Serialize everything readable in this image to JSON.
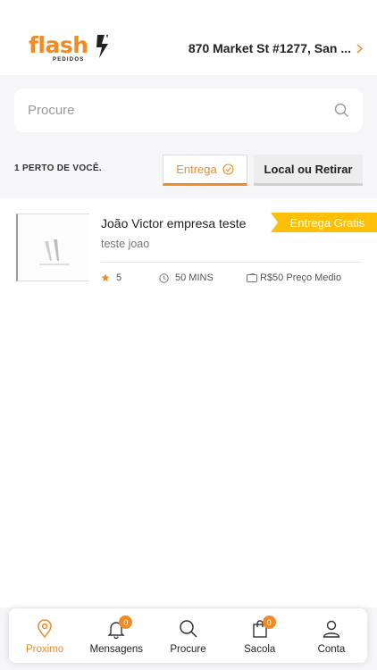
{
  "brand": {
    "logo_text": "flash",
    "logo_subtext": "PEDIDOS"
  },
  "header": {
    "address": "870 Market St #1277, San ..."
  },
  "search": {
    "placeholder": "Procure"
  },
  "filters": {
    "nearby_count_label": "1 PERTO DE VOCÊ.",
    "tabs": [
      {
        "label": "Entrega",
        "selected": true
      },
      {
        "label": "Local ou Retirar",
        "selected": false
      }
    ]
  },
  "restaurants": [
    {
      "name": "João Victor empresa teste",
      "description": "teste joao",
      "badge": "Entrega Gratis",
      "rating": "5",
      "time": "50 MINS",
      "price": "R$50 Preço Medio"
    }
  ],
  "bottom_nav": {
    "items": [
      {
        "label": "Proximo",
        "icon": "location-pin-icon",
        "active": true
      },
      {
        "label": "Mensagens",
        "icon": "bell-icon",
        "badge": "0"
      },
      {
        "label": "Procure",
        "icon": "search-icon"
      },
      {
        "label": "Sacola",
        "icon": "bag-icon",
        "badge": "0"
      },
      {
        "label": "Conta",
        "icon": "user-icon"
      }
    ]
  },
  "colors": {
    "accent": "#f08a24",
    "badge_yellow": "#fdc006",
    "star": "#f08a24"
  }
}
